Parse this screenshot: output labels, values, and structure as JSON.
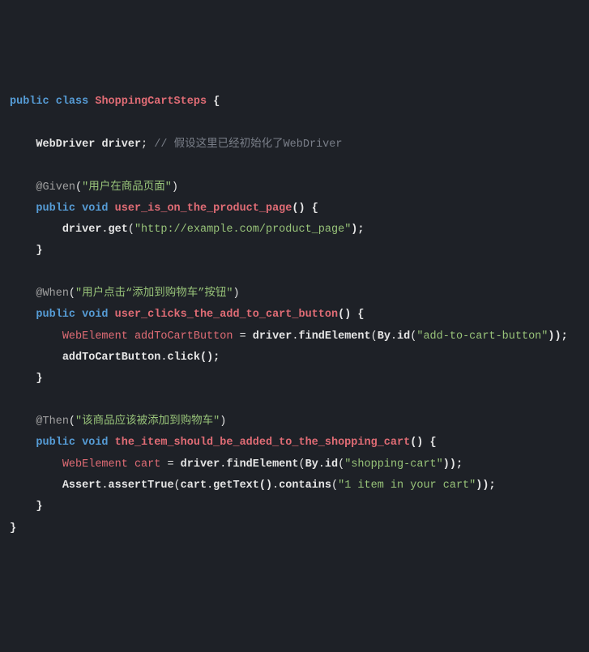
{
  "line1": {
    "kw_public": "public",
    "kw_class": "class",
    "className": "ShoppingCartSteps",
    "brace": "{"
  },
  "blank": "",
  "line3": {
    "type": "WebDriver",
    "varName": "driver",
    "semi": ";",
    "comment": "// 假设这里已经初始化了WebDriver"
  },
  "line5": {
    "ann_at": "@",
    "ann_name": "Given",
    "open": "(",
    "str": "\"用户在商品页面\"",
    "close": ")"
  },
  "line6": {
    "kw_public": "public",
    "kw_void": "void",
    "mname": "user_is_on_the_product_page",
    "parens": "()",
    "brace": "{"
  },
  "line7": {
    "obj": "driver",
    "dot": ".",
    "method": "get",
    "open": "(",
    "str": "\"http://example.com/product_page\"",
    "close": ");"
  },
  "line8": {
    "brace": "}"
  },
  "line10": {
    "ann_at": "@",
    "ann_name": "When",
    "open": "(",
    "str": "\"用户点击“添加到购物车”按钮\"",
    "close": ")"
  },
  "line11": {
    "kw_public": "public",
    "kw_void": "void",
    "mname": "user_clicks_the_add_to_cart_button",
    "parens": "()",
    "brace": "{"
  },
  "line12": {
    "type": "WebElement",
    "varName": "addToCartButton",
    "eq": " = ",
    "obj": "driver",
    "dot1": ".",
    "m1": "findElement",
    "open1": "(",
    "byClass": "By",
    "dot2": ".",
    "m2": "id",
    "open2": "(",
    "str": "\"add-to-cart-button\"",
    "close": "));"
  },
  "line13": {
    "obj": "addToCartButton",
    "dot": ".",
    "method": "click",
    "call": "();"
  },
  "line14": {
    "brace": "}"
  },
  "line16": {
    "ann_at": "@",
    "ann_name": "Then",
    "open": "(",
    "str": "\"该商品应该被添加到购物车\"",
    "close": ")"
  },
  "line17": {
    "kw_public": "public",
    "kw_void": "void",
    "mname": "the_item_should_be_added_to_the_shopping_cart",
    "parens": "()",
    "brace": "{"
  },
  "line18": {
    "type": "WebElement",
    "varName": "cart",
    "eq": " = ",
    "obj": "driver",
    "dot1": ".",
    "m1": "findElement",
    "open1": "(",
    "byClass": "By",
    "dot2": ".",
    "m2": "id",
    "open2": "(",
    "str": "\"shopping-cart\"",
    "close": "));"
  },
  "line19": {
    "cls": "Assert",
    "dot1": ".",
    "m1": "assertTrue",
    "open1": "(",
    "obj": "cart",
    "dot2": ".",
    "m2": "getText",
    "call2": "()",
    "dot3": ".",
    "m3": "contains",
    "open3": "(",
    "str": "\"1 item in your cart\"",
    "close": "));"
  },
  "line20": {
    "brace": "}"
  },
  "line21": {
    "brace": "}"
  }
}
